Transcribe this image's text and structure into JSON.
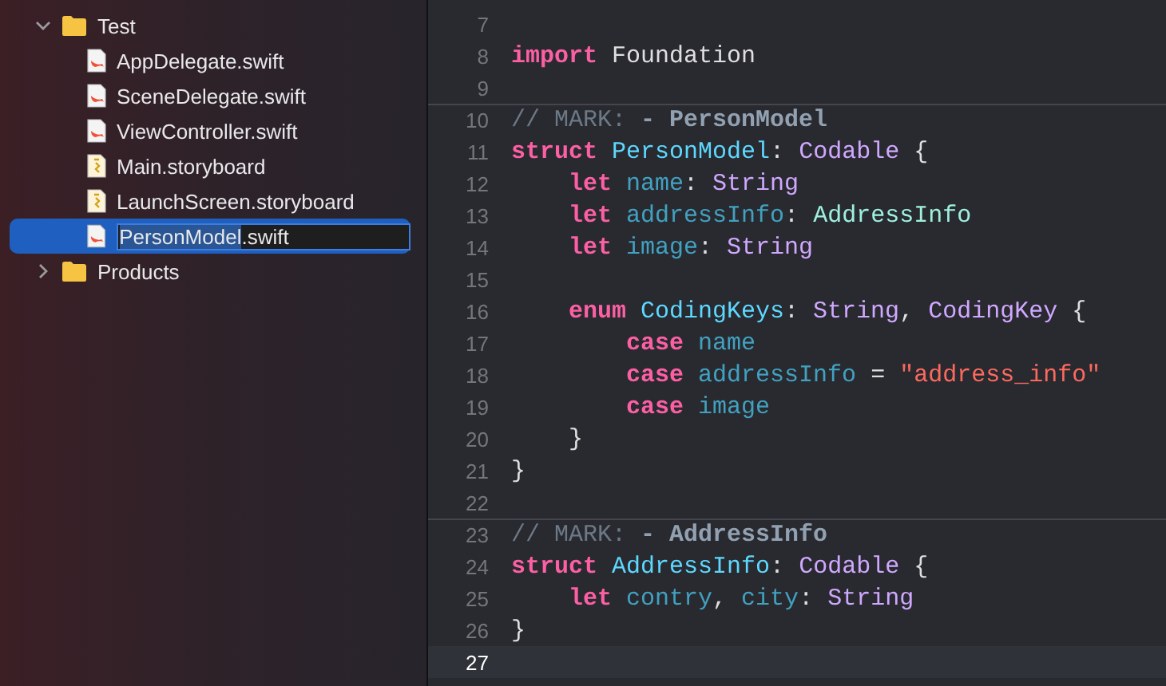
{
  "navigator": {
    "groups": [
      {
        "name": "Test",
        "expanded": true,
        "children": [
          {
            "name": "AppDelegate.swift",
            "kind": "swift",
            "selected": false
          },
          {
            "name": "SceneDelegate.swift",
            "kind": "swift",
            "selected": false
          },
          {
            "name": "ViewController.swift",
            "kind": "swift",
            "selected": false
          },
          {
            "name": "Main.storyboard",
            "kind": "storyboard",
            "selected": false
          },
          {
            "name": "LaunchScreen.storyboard",
            "kind": "storyboard",
            "selected": false
          },
          {
            "name": "PersonModel",
            "rest": ".swift",
            "kind": "swift",
            "selected": true,
            "editing": true
          }
        ]
      },
      {
        "name": "Products",
        "expanded": false
      }
    ]
  },
  "editor": {
    "lines": [
      {
        "number": "7",
        "current": false
      },
      {
        "number": "8",
        "current": false,
        "tokens": [
          {
            "kind": "keyword",
            "text": "import"
          },
          {
            "kind": "plain",
            "text": " Foundation"
          }
        ]
      },
      {
        "number": "9",
        "current": false
      },
      {
        "number": "10",
        "current": false,
        "tokens": [
          {
            "kind": "comment",
            "text": "// MARK: "
          },
          {
            "kind": "markname",
            "text": "- PersonModel"
          }
        ]
      },
      {
        "number": "11",
        "current": false,
        "tokens": [
          {
            "kind": "keyword",
            "text": "struct "
          },
          {
            "kind": "decl",
            "text": "PersonModel"
          },
          {
            "kind": "plain",
            "text": ": "
          },
          {
            "kind": "type",
            "text": "Codable"
          },
          {
            "kind": "plain",
            "text": " {"
          }
        ]
      },
      {
        "number": "12",
        "current": false,
        "tokens": [
          {
            "kind": "keyword",
            "text": "    let "
          },
          {
            "kind": "prop",
            "text": "name"
          },
          {
            "kind": "plain",
            "text": ": "
          },
          {
            "kind": "type",
            "text": "String"
          }
        ]
      },
      {
        "number": "13",
        "current": false,
        "tokens": [
          {
            "kind": "keyword",
            "text": "    let "
          },
          {
            "kind": "prop",
            "text": "addressInfo"
          },
          {
            "kind": "plain",
            "text": ": "
          },
          {
            "kind": "decltype",
            "text": "AddressInfo"
          }
        ]
      },
      {
        "number": "14",
        "current": false,
        "tokens": [
          {
            "kind": "keyword",
            "text": "    let "
          },
          {
            "kind": "prop",
            "text": "image"
          },
          {
            "kind": "plain",
            "text": ": "
          },
          {
            "kind": "type",
            "text": "String"
          }
        ]
      },
      {
        "number": "15",
        "current": false
      },
      {
        "number": "16",
        "current": false,
        "tokens": [
          {
            "kind": "keyword",
            "text": "    enum "
          },
          {
            "kind": "decl",
            "text": "CodingKeys"
          },
          {
            "kind": "plain",
            "text": ": "
          },
          {
            "kind": "type",
            "text": "String"
          },
          {
            "kind": "plain",
            "text": ", "
          },
          {
            "kind": "type",
            "text": "CodingKey"
          },
          {
            "kind": "plain",
            "text": " {"
          }
        ]
      },
      {
        "number": "17",
        "current": false,
        "tokens": [
          {
            "kind": "keyword",
            "text": "        case "
          },
          {
            "kind": "prop",
            "text": "name"
          }
        ]
      },
      {
        "number": "18",
        "current": false,
        "tokens": [
          {
            "kind": "keyword",
            "text": "        case "
          },
          {
            "kind": "prop",
            "text": "addressInfo"
          },
          {
            "kind": "plain",
            "text": " = "
          },
          {
            "kind": "string",
            "text": "\"address_info\""
          }
        ]
      },
      {
        "number": "19",
        "current": false,
        "tokens": [
          {
            "kind": "keyword",
            "text": "        case "
          },
          {
            "kind": "prop",
            "text": "image"
          }
        ]
      },
      {
        "number": "20",
        "current": false,
        "tokens": [
          {
            "kind": "plain",
            "text": "    }"
          }
        ]
      },
      {
        "number": "21",
        "current": false,
        "tokens": [
          {
            "kind": "plain",
            "text": "}"
          }
        ]
      },
      {
        "number": "22",
        "current": false
      },
      {
        "number": "23",
        "current": false,
        "tokens": [
          {
            "kind": "comment",
            "text": "// MARK: "
          },
          {
            "kind": "markname",
            "text": "- AddressInfo"
          }
        ]
      },
      {
        "number": "24",
        "current": false,
        "tokens": [
          {
            "kind": "keyword",
            "text": "struct "
          },
          {
            "kind": "decl",
            "text": "AddressInfo"
          },
          {
            "kind": "plain",
            "text": ": "
          },
          {
            "kind": "type",
            "text": "Codable"
          },
          {
            "kind": "plain",
            "text": " {"
          }
        ]
      },
      {
        "number": "25",
        "current": false,
        "tokens": [
          {
            "kind": "keyword",
            "text": "    let "
          },
          {
            "kind": "prop",
            "text": "contry"
          },
          {
            "kind": "plain",
            "text": ", "
          },
          {
            "kind": "prop",
            "text": "city"
          },
          {
            "kind": "plain",
            "text": ": "
          },
          {
            "kind": "type",
            "text": "String"
          }
        ]
      },
      {
        "number": "26",
        "current": false,
        "tokens": [
          {
            "kind": "plain",
            "text": "}"
          }
        ]
      },
      {
        "number": "27",
        "current": true
      }
    ]
  }
}
